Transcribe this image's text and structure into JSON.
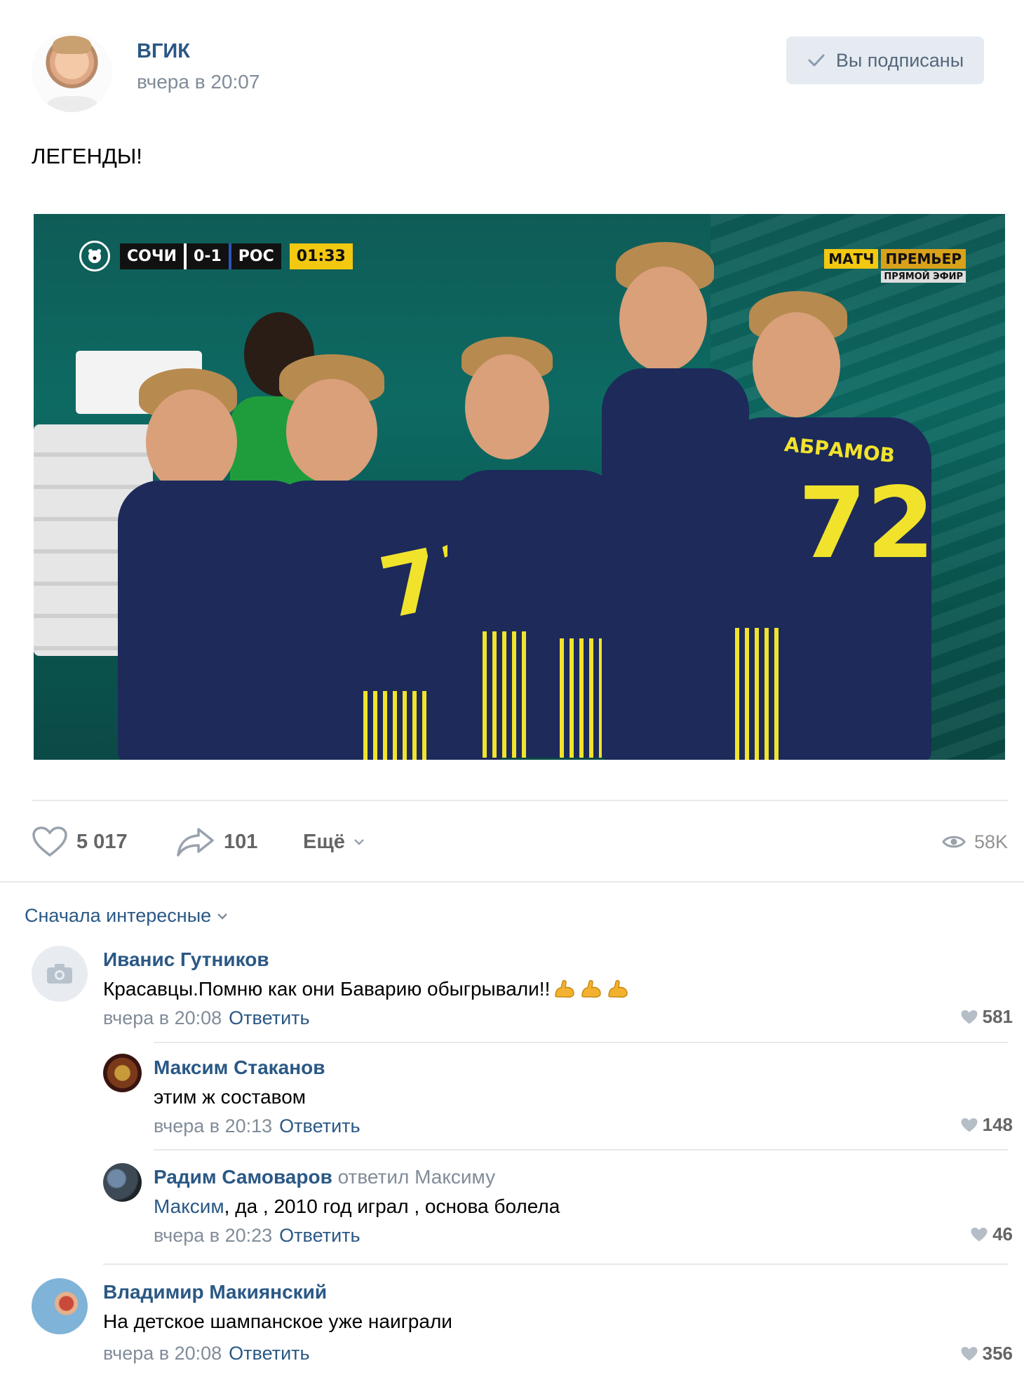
{
  "post": {
    "author": "ВГИК",
    "time": "вчера в 20:07",
    "subscribe_label": "Вы подписаны",
    "text": "ЛЕГЕНДЫ!",
    "photo": {
      "scoreboard": {
        "home": "СОЧИ",
        "score": "0-1",
        "away": "РОС",
        "clock": "01:33"
      },
      "channel": {
        "part1": "МАТЧ",
        "part2": "ПРЕМЬЕР",
        "live": "ПРЯМОЙ ЭФИР"
      },
      "jersey_number_a": "71",
      "jersey_number_b": "72",
      "jersey_name_b": "АБРАМОВ"
    },
    "likes": "5 017",
    "shares": "101",
    "more_label": "Ещё",
    "views": "58K"
  },
  "comments": {
    "sort_label": "Сначала интересные",
    "items": [
      {
        "author": "Иванис Гутников",
        "text": "Красавцы.Помню как они Баварию обыгрывали!!",
        "time": "вчера в 20:08",
        "reply_label": "Ответить",
        "likes": "581"
      },
      {
        "author": "Максим Стаканов",
        "text": "этим ж составом",
        "time": "вчера в 20:13",
        "reply_label": "Ответить",
        "likes": "148"
      },
      {
        "author": "Радим Самоваров",
        "reply_to": "ответил Максиму",
        "mention": "Максим",
        "text": ", да , 2010 год играл , основа болела",
        "time": "вчера в 20:23",
        "reply_label": "Ответить",
        "likes": "46"
      },
      {
        "author": "Владимир Макиянский",
        "text": "На детское шампанское уже наиграли",
        "time": "вчера в 20:08",
        "reply_label": "Ответить",
        "likes": "356"
      }
    ]
  },
  "colors": {
    "link": "#2a5885",
    "meta": "#818c99",
    "button_bg": "#e5ebf1",
    "divider": "#e7e8ec"
  }
}
